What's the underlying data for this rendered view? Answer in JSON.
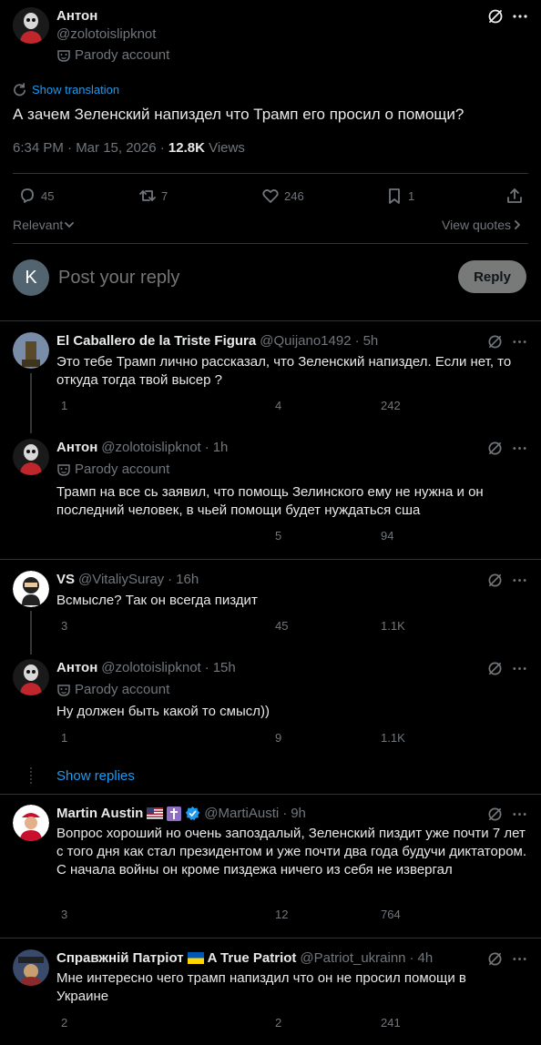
{
  "main_post": {
    "author_name": "Антон",
    "author_handle": "@zolotoislipknot",
    "parody_label": "Parody account",
    "show_translation": "Show translation",
    "text": "А зачем Зеленский напиздел что Трамп его просил о помощи?",
    "meta_time": "6:34 PM · Mar 15, 2026 · ",
    "views_count": "12.8K",
    "views_label": " Views",
    "replies": "45",
    "reposts": "7",
    "likes": "246",
    "bookmarks": "1"
  },
  "sort": {
    "relevant": "Relevant",
    "view_quotes": "View quotes"
  },
  "composer": {
    "avatar_letter": "K",
    "placeholder": "Post your reply",
    "reply_button": "Reply"
  },
  "replies": [
    {
      "name": "El Caballero de la Triste Figura",
      "handle": "@Quijano1492",
      "time": "5h",
      "text": "Это тебе Трамп лично рассказал, что Зеленский напиздел. Если нет, то откуда тогда твой высер ?",
      "replies": "1",
      "reposts": "",
      "likes": "4",
      "views": "242"
    },
    {
      "name": "Антон",
      "handle": "@zolotoislipknot",
      "time": "1h",
      "parody": "Parody account",
      "text": "Трамп на все сь заявил, что помощь Зелинского ему не нужна и он последний человек, в чьей помощи будет нуждаться сша",
      "replies": "",
      "reposts": "",
      "likes": "5",
      "views": "94"
    },
    {
      "name": "VS",
      "handle": "@VitaliySuray",
      "time": "16h",
      "text": "Всмысле? Так он всегда пиздит",
      "replies": "3",
      "reposts": "",
      "likes": "45",
      "views": "1.1K"
    },
    {
      "name": "Антон",
      "handle": "@zolotoislipknot",
      "time": "15h",
      "parody": "Parody account",
      "text": "Ну должен быть какой то смысл))",
      "replies": "1",
      "reposts": "",
      "likes": "9",
      "views": "1.1K"
    },
    {
      "name": "Martin Austin",
      "handle": "@MartiAusti",
      "time": "9h",
      "text": "Вопрос хороший но очень запоздалый, Зеленский пиздит уже почти 7 лет с того дня как стал президентом и уже почти два года будучи диктатором. С начала войны он кроме пиздежа ничего из себя не извергал",
      "replies": "3",
      "reposts": "",
      "likes": "12",
      "views": "764"
    },
    {
      "name": "Справжній Патріот",
      "name_suffix": "A True Patriot",
      "handle": "@Patriot_ukrainn",
      "time": "4h",
      "text": "Мне интересно чего трамп напиздил что он не просил помощи в Украине",
      "replies": "2",
      "reposts": "",
      "likes": "2",
      "views": "241"
    }
  ],
  "show_replies": "Show replies",
  "colors": {
    "accent": "#1d9bf0",
    "background": "#000000",
    "muted": "#71767b",
    "divider": "#2f3336"
  },
  "icons": [
    "grok-slash-icon",
    "more-icon",
    "reply-icon",
    "repost-icon",
    "like-icon",
    "bookmark-icon",
    "share-icon",
    "views-icon",
    "parody-mask-icon",
    "translate-icon",
    "verified-icon"
  ]
}
